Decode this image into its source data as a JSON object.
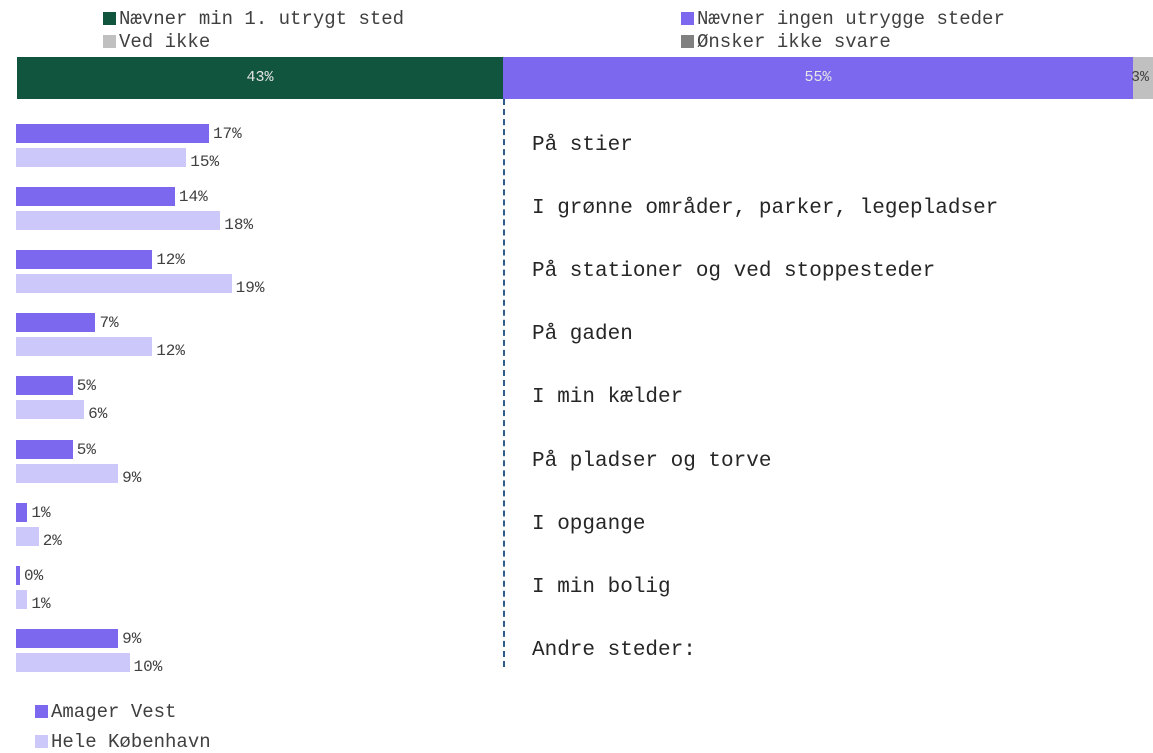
{
  "colors": {
    "mentions_place": "#12553f",
    "mentions_none": "#7b68ee",
    "dont_know": "#c0c0c0",
    "no_answer": "#808080",
    "amager_vest": "#7b68ee",
    "hele_kobenhavn": "#ccc8fa"
  },
  "legend_top": [
    {
      "label": "Nævner min 1. utrygt sted",
      "color": "#12553f"
    },
    {
      "label": "Nævner ingen utrygge steder",
      "color": "#7b68ee"
    },
    {
      "label": "Ved ikke",
      "color": "#c0c0c0"
    },
    {
      "label": "Ønsker ikke svare",
      "color": "#808080"
    }
  ],
  "legend_bottom": [
    {
      "label": "Amager Vest",
      "color": "#7b68ee"
    },
    {
      "label": "Hele København",
      "color": "#ccc8fa"
    }
  ],
  "chart_data": [
    {
      "type": "bar",
      "orientation": "horizontal-stacked",
      "series": [
        {
          "name": "Nævner min 1. utrygt sted",
          "value": 43,
          "label": "43%"
        },
        {
          "name": "Nævner ingen utrygge steder",
          "value": 55,
          "label": "55%"
        },
        {
          "name": "Ved ikke",
          "value": 3,
          "label": "3%"
        },
        {
          "name": "Ønsker ikke svare",
          "value": 0,
          "label": ""
        }
      ],
      "legend_placement": "top"
    },
    {
      "type": "bar",
      "orientation": "horizontal-grouped",
      "categories": [
        "På stier",
        "I grønne områder, parker, legepladser",
        "På stationer og ved stoppesteder",
        "På gaden",
        "I min kælder",
        "På pladser og torve",
        "I opgange",
        "I min bolig",
        "Andre steder:"
      ],
      "series": [
        {
          "name": "Amager Vest",
          "values": [
            17,
            14,
            12,
            7,
            5,
            5,
            1,
            0,
            9
          ],
          "labels": [
            "17%",
            "14%",
            "12%",
            "7%",
            "5%",
            "5%",
            "1%",
            "0%",
            "9%"
          ]
        },
        {
          "name": "Hele København",
          "values": [
            15,
            18,
            19,
            12,
            6,
            9,
            2,
            1,
            10
          ],
          "labels": [
            "15%",
            "18%",
            "19%",
            "12%",
            "6%",
            "9%",
            "2%",
            "1%",
            "10%"
          ]
        }
      ],
      "legend_placement": "bottom-left",
      "grid": false
    }
  ]
}
